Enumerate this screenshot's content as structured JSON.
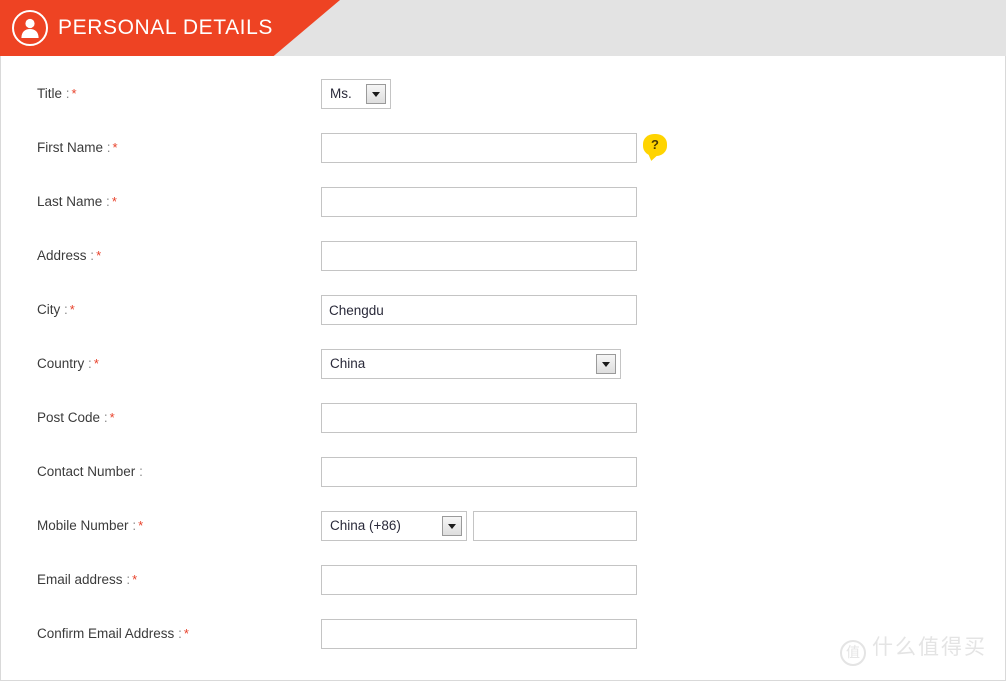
{
  "header": {
    "title": "PERSONAL DETAILS",
    "icon": "person-icon",
    "banner_color": "#ee4323",
    "strip_color": "#e3e3e3"
  },
  "form": {
    "required_marker": "*",
    "rows": [
      {
        "label": "Title",
        "colon": ":",
        "required": true,
        "control": "select",
        "value": "Ms.",
        "name": "title"
      },
      {
        "label": "First Name",
        "colon": ":",
        "required": true,
        "control": "text",
        "value": "",
        "placeholder": "",
        "name": "first-name",
        "help": "?"
      },
      {
        "label": "Last Name",
        "colon": ":",
        "required": true,
        "control": "text",
        "value": "",
        "placeholder": "",
        "name": "last-name"
      },
      {
        "label": "Address",
        "colon": ":",
        "required": true,
        "control": "text",
        "value": "",
        "placeholder": "",
        "name": "address"
      },
      {
        "label": "City",
        "colon": ":",
        "required": true,
        "control": "text",
        "value": "Chengdu",
        "placeholder": "",
        "name": "city"
      },
      {
        "label": "Country",
        "colon": ":",
        "required": true,
        "control": "select",
        "value": "China",
        "name": "country"
      },
      {
        "label": "Post Code",
        "colon": ":",
        "required": true,
        "control": "text",
        "value": "",
        "placeholder": "",
        "name": "post-code"
      },
      {
        "label": "Contact Number",
        "colon": ":",
        "required": false,
        "control": "text",
        "value": "",
        "placeholder": "",
        "name": "contact-number"
      },
      {
        "label": "Mobile Number",
        "colon": ":",
        "required": true,
        "control": "select-plus-text",
        "value": "China (+86)",
        "second_value": "",
        "name": "mobile-number"
      },
      {
        "label": "Email address",
        "colon": ":",
        "required": true,
        "control": "text",
        "value": "",
        "placeholder": "",
        "name": "email-address"
      },
      {
        "label": "Confirm Email Address",
        "colon": ":",
        "required": true,
        "control": "text",
        "value": "",
        "placeholder": "",
        "name": "confirm-email-address"
      }
    ]
  },
  "watermark": {
    "logo": "值",
    "text": "什么值得买"
  },
  "colors": {
    "accent_red": "#ee4323",
    "required_red": "#e8412a",
    "help_yellow": "#ffd400",
    "label_text": "#3b3b3b",
    "border": "#c4c4c4"
  }
}
